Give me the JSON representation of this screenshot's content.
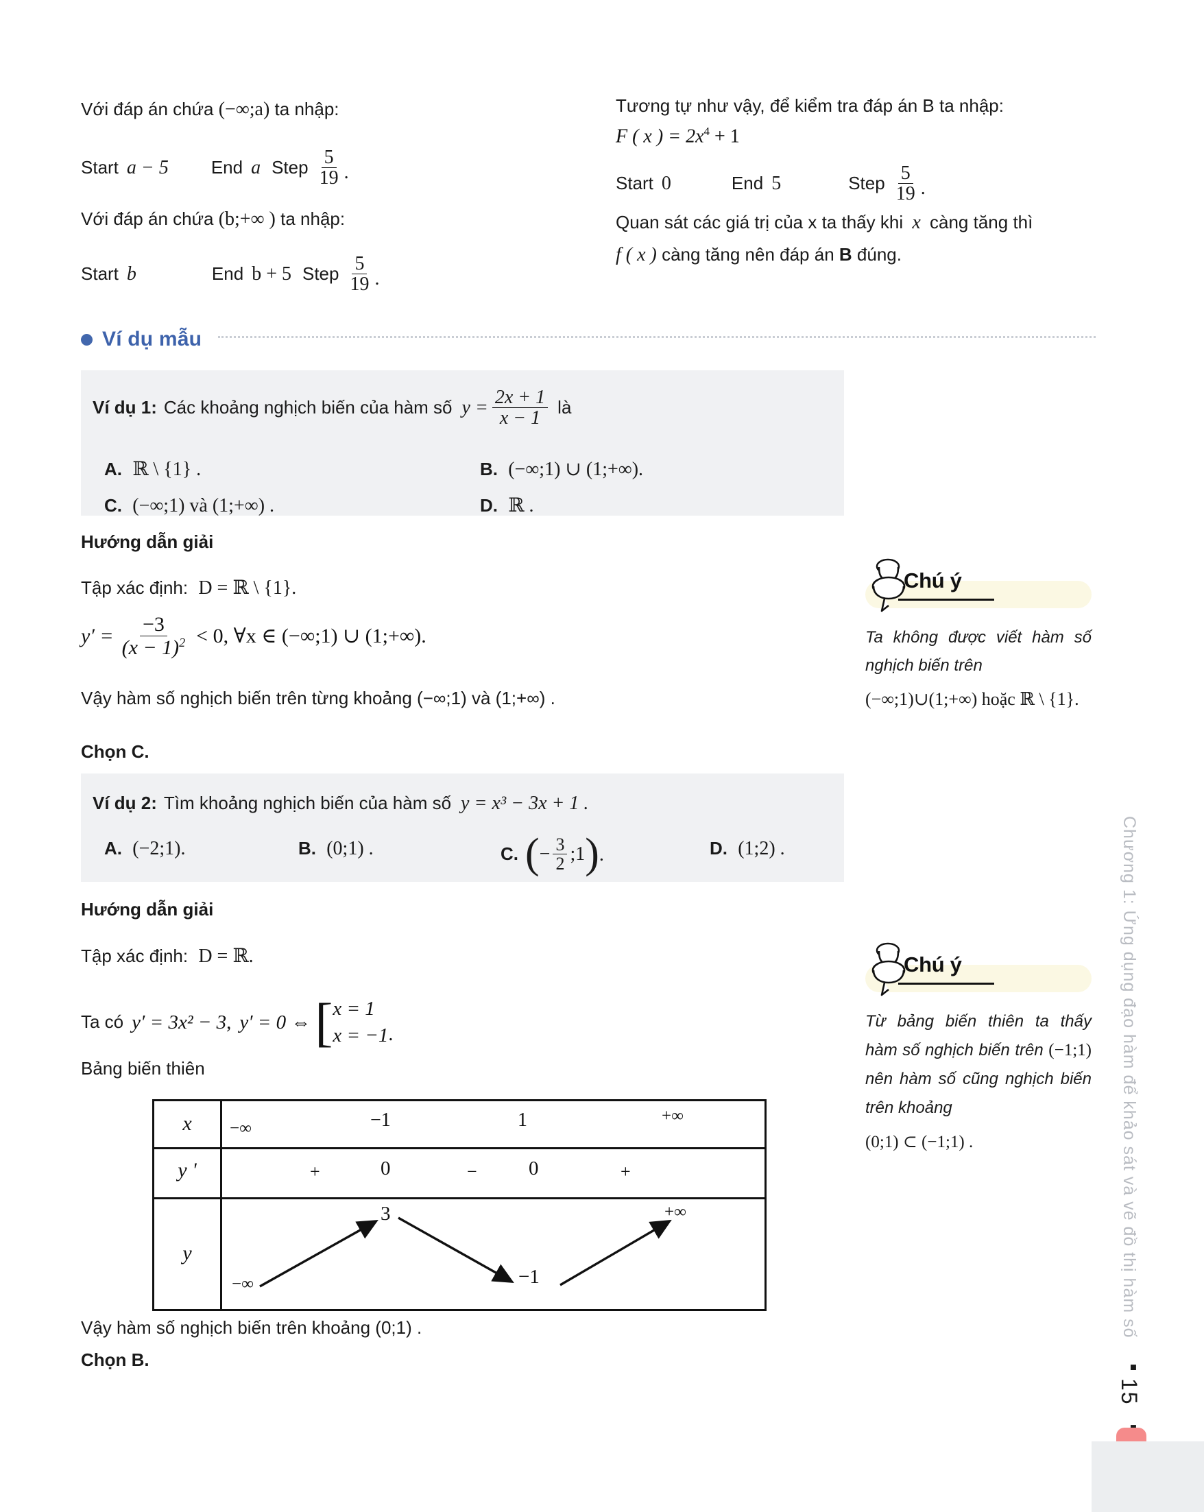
{
  "top_left": {
    "line1": "Với đáp án chứa (−∞;a) ta nhập:",
    "line1_pre": "Với đáp án chứa",
    "line1_interval": "(−∞;a)",
    "line1_post": "ta nhập:",
    "row1_start_label": "Start",
    "row1_start_value": "a − 5",
    "row1_end_label": "End",
    "row1_end_value": "a",
    "row1_step_label": "Step",
    "row1_step_num": "5",
    "row1_step_den": "19",
    "line2_pre": "Với đáp án chứa",
    "line2_interval": "(b;+∞ )",
    "line2_post": "ta nhập:",
    "row2_start_label": "Start",
    "row2_start_value": "b",
    "row2_end_label": "End",
    "row2_end_value": "b + 5",
    "row2_step_label": "Step",
    "row2_step_num": "5",
    "row2_step_den": "19"
  },
  "top_right": {
    "intro": "Tương tự như vậy, để kiểm tra đáp án B ta nhập:",
    "formula_lhs": "F ( x ) = 2x",
    "formula_exp": "4",
    "formula_rhs": "+ 1",
    "start_label": "Start",
    "start_value": "0",
    "end_label": "End",
    "end_value": "5",
    "step_label": "Step",
    "step_num": "5",
    "step_den": "19",
    "conclusion_1": "Quan sát các giá trị của x ta thấy khi",
    "conclusion_x": "x",
    "conclusion_2": "càng tăng thì",
    "conclusion_fx": "f ( x )",
    "conclusion_3": "càng tăng nên đáp án",
    "conclusion_b": "B",
    "conclusion_4": "đúng."
  },
  "section": {
    "bullet": "bullet-icon",
    "title": "Ví dụ mẫu"
  },
  "example1": {
    "label": "Ví dụ 1:",
    "prompt": "Các khoảng nghịch biến của hàm số",
    "fn_lhs": "y =",
    "fn_num": "2x + 1",
    "fn_den": "x − 1",
    "fn_tail": "là",
    "options": [
      {
        "key": "A.",
        "text": "ℝ \\ {1} ."
      },
      {
        "key": "B.",
        "text": "(−∞;1) ∪ (1;+∞)."
      },
      {
        "key": "C.",
        "text": "(−∞;1) và (1;+∞) ."
      },
      {
        "key": "D.",
        "text": "ℝ ."
      }
    ]
  },
  "solution1": {
    "heading": "Hướng dẫn giải",
    "domain_label": "Tập xác định:",
    "domain_value": "D = ℝ \\ {1}.",
    "deriv_lhs": "y′ =",
    "deriv_num": "−3",
    "deriv_den": "(x − 1)",
    "deriv_den_exp": "2",
    "deriv_rhs": "< 0, ∀x ∈ (−∞;1) ∪ (1;+∞).",
    "conclusion": "Vậy hàm số nghịch biến trên từng khoảng (−∞;1) và (1;+∞) .",
    "choose": "Chọn C."
  },
  "note1": {
    "icon": "pushpin-icon",
    "title": "Chú ý",
    "line1": "Ta không được viết hàm số nghịch biến trên",
    "line2": "(−∞;1)∪(1;+∞) hoặc ℝ \\ {1}."
  },
  "example2": {
    "label": "Ví dụ 2:",
    "prompt": "Tìm khoảng nghịch biến của hàm số",
    "fn": "y = x³ − 3x + 1 .",
    "options": [
      {
        "key": "A.",
        "text": "(−2;1)."
      },
      {
        "key": "B.",
        "text": "(0;1) ."
      },
      {
        "key": "C.",
        "text": "(−3/2;1) .",
        "frac_num": "3",
        "frac_den": "2",
        "pre": "−",
        "post": ";1"
      },
      {
        "key": "D.",
        "text": "(1;2) ."
      }
    ]
  },
  "solution2": {
    "heading": "Hướng dẫn giải",
    "domain_label": "Tập xác định:",
    "domain_value": "D = ℝ.",
    "deriv_pre": "Ta có",
    "deriv_1": "y′ = 3x² − 3,",
    "deriv_2": "y′ = 0 ⇔",
    "case1": "x = 1",
    "case2": "x = −1",
    "case_dot": ".",
    "table_label": "Bảng biến thiên",
    "conclusion": "Vậy hàm số nghịch biến trên khoảng (0;1) .",
    "choose": "Chọn B."
  },
  "note2": {
    "icon": "pushpin-icon",
    "title": "Chú ý",
    "line1": "Từ bảng biến thiên ta thấy hàm số nghịch biến trên",
    "line2": "(−1;1)",
    "line3": "nên hàm số cũng nghịch biến trên khoảng",
    "line4": "(0;1) ⊂ (−1;1) ."
  },
  "variation_table": {
    "rows": [
      "x",
      "y '",
      "y"
    ],
    "x_values": [
      "−∞",
      "−1",
      "1",
      "+∞"
    ],
    "yprime_signs": [
      "+",
      "0",
      "−",
      "0",
      "+"
    ],
    "y_values": [
      "−∞",
      "3",
      "−1",
      "+∞"
    ],
    "arrows": [
      "up",
      "down",
      "up"
    ]
  },
  "footer": {
    "chapter": "Chương 1: Ứng dụng đạo hàm để khảo sát và vẽ đồ thị hàm số",
    "sep_left": "▪",
    "page_number": "15",
    "sep_right": "▪",
    "accent_color": "#f58b8b"
  }
}
